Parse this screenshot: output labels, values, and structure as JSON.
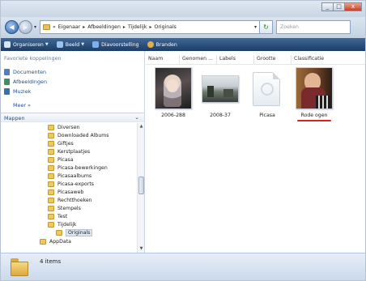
{
  "window": {
    "caption_buttons": [
      "_",
      "□",
      "x"
    ]
  },
  "address": {
    "back_glyph": "◀",
    "forward_glyph": "▶",
    "crumbs": [
      "«",
      "Eigenaar",
      "Afbeeldingen",
      "Tijdelijk",
      "Originals"
    ],
    "crumb_separator": "▸",
    "refresh_glyph": "↻",
    "search_placeholder": "Zoeken"
  },
  "toolbar": {
    "items": [
      {
        "label": "Organiseren",
        "icon": "organize-icon",
        "color": "#d8e6f6"
      },
      {
        "label": "Beeld",
        "icon": "views-icon",
        "color": "#9fc3ec"
      },
      {
        "label": "Diavoorstelling",
        "icon": "slideshow-icon",
        "color": "#7fb0e8"
      },
      {
        "label": "Branden",
        "icon": "burn-icon",
        "color": "#e0b04a"
      }
    ]
  },
  "navigation": {
    "favorites_header": "Favoriete koppelingen",
    "favorites": [
      {
        "label": "Documenten",
        "icon": "documents-icon",
        "color": "#4e7fbf"
      },
      {
        "label": "Afbeeldingen",
        "icon": "pictures-icon",
        "color": "#3f8f5f"
      },
      {
        "label": "Muziek",
        "icon": "music-icon",
        "color": "#3a6fb3"
      }
    ],
    "more": "Meer »",
    "folders_header": "Mappen",
    "folders_chevron": "⌄",
    "tree": [
      {
        "label": "Diversen",
        "level": 0
      },
      {
        "label": "Downloaded Albums",
        "level": 0
      },
      {
        "label": "Giftjes",
        "level": 0
      },
      {
        "label": "Kerstplaatjes",
        "level": 0
      },
      {
        "label": "Picasa",
        "level": 0
      },
      {
        "label": "Picasa-bewerkingen",
        "level": 0
      },
      {
        "label": "Picasaalbums",
        "level": 0
      },
      {
        "label": "Picasa-exports",
        "level": 0
      },
      {
        "label": "Picasaweb",
        "level": 0
      },
      {
        "label": "Rechtthoeken",
        "level": 0
      },
      {
        "label": "Stempels",
        "level": 0
      },
      {
        "label": "Test",
        "level": 0
      },
      {
        "label": "Tijdelijk",
        "level": 0
      },
      {
        "label": "Originals",
        "level": 1,
        "selected": true
      },
      {
        "label": "AppData",
        "level": -1
      }
    ]
  },
  "content": {
    "columns": [
      "Naam",
      "Genomen ...",
      "Labels",
      "Grootte",
      "Classificatie"
    ],
    "items": [
      {
        "label": "2006-288",
        "kind": "portrait-photo"
      },
      {
        "label": "2008-37",
        "kind": "landscape-photo"
      },
      {
        "label": "Picasa",
        "kind": "folder-doc"
      },
      {
        "label": "Rode ogen",
        "kind": "red-eye-photo",
        "underlined": true
      }
    ]
  },
  "status": {
    "text": "4 items"
  }
}
